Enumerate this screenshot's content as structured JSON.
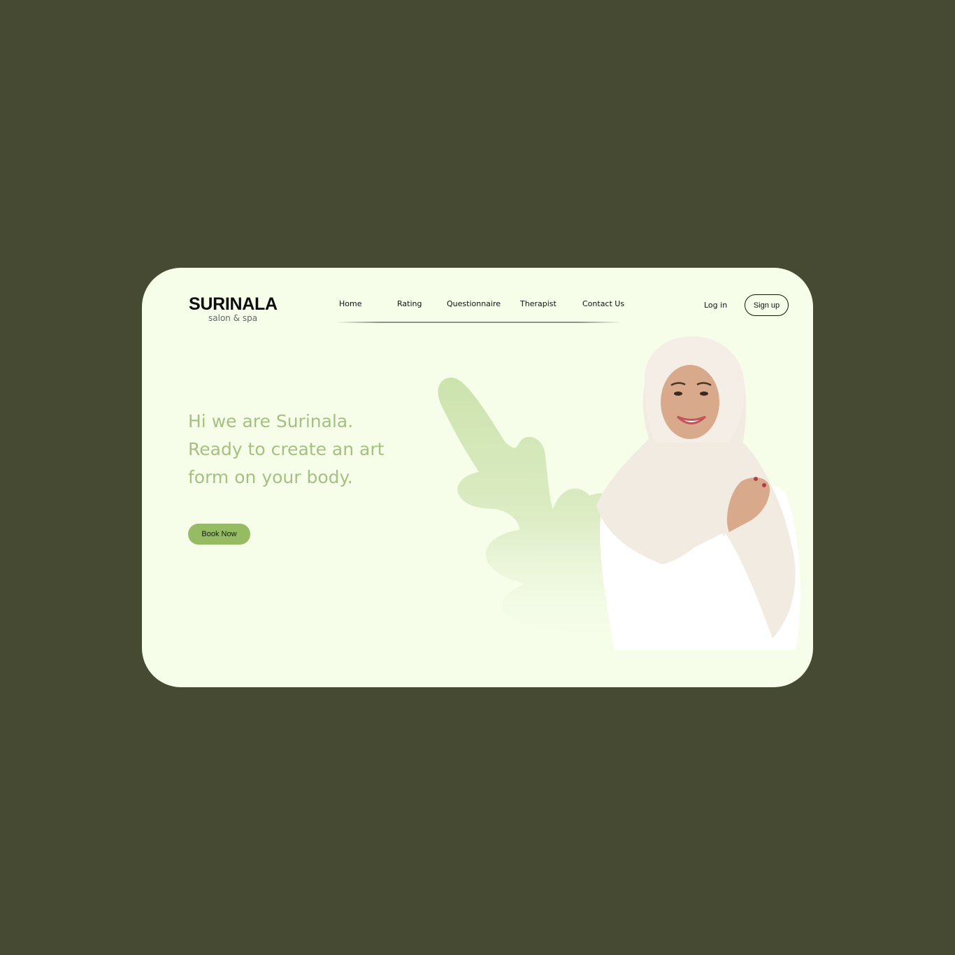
{
  "brand": {
    "name": "SURINALA",
    "tagline": "salon & spa"
  },
  "nav": {
    "items": [
      {
        "label": "Home"
      },
      {
        "label": "Rating"
      },
      {
        "label": "Questionnaire"
      },
      {
        "label": "Therapist"
      },
      {
        "label": "Contact Us"
      }
    ]
  },
  "auth": {
    "login_label": "Log in",
    "signup_label": "Sign up"
  },
  "hero": {
    "line1": "Hi we are Surinala.",
    "line2": "Ready to create an art",
    "line3": "form on your body.",
    "cta_label": "Book Now"
  },
  "colors": {
    "page_background": "#464a32",
    "card_background": "#f6feea",
    "headline": "#a7bf80",
    "accent_button": "#95bc62",
    "leaf": "#cde3b0"
  }
}
